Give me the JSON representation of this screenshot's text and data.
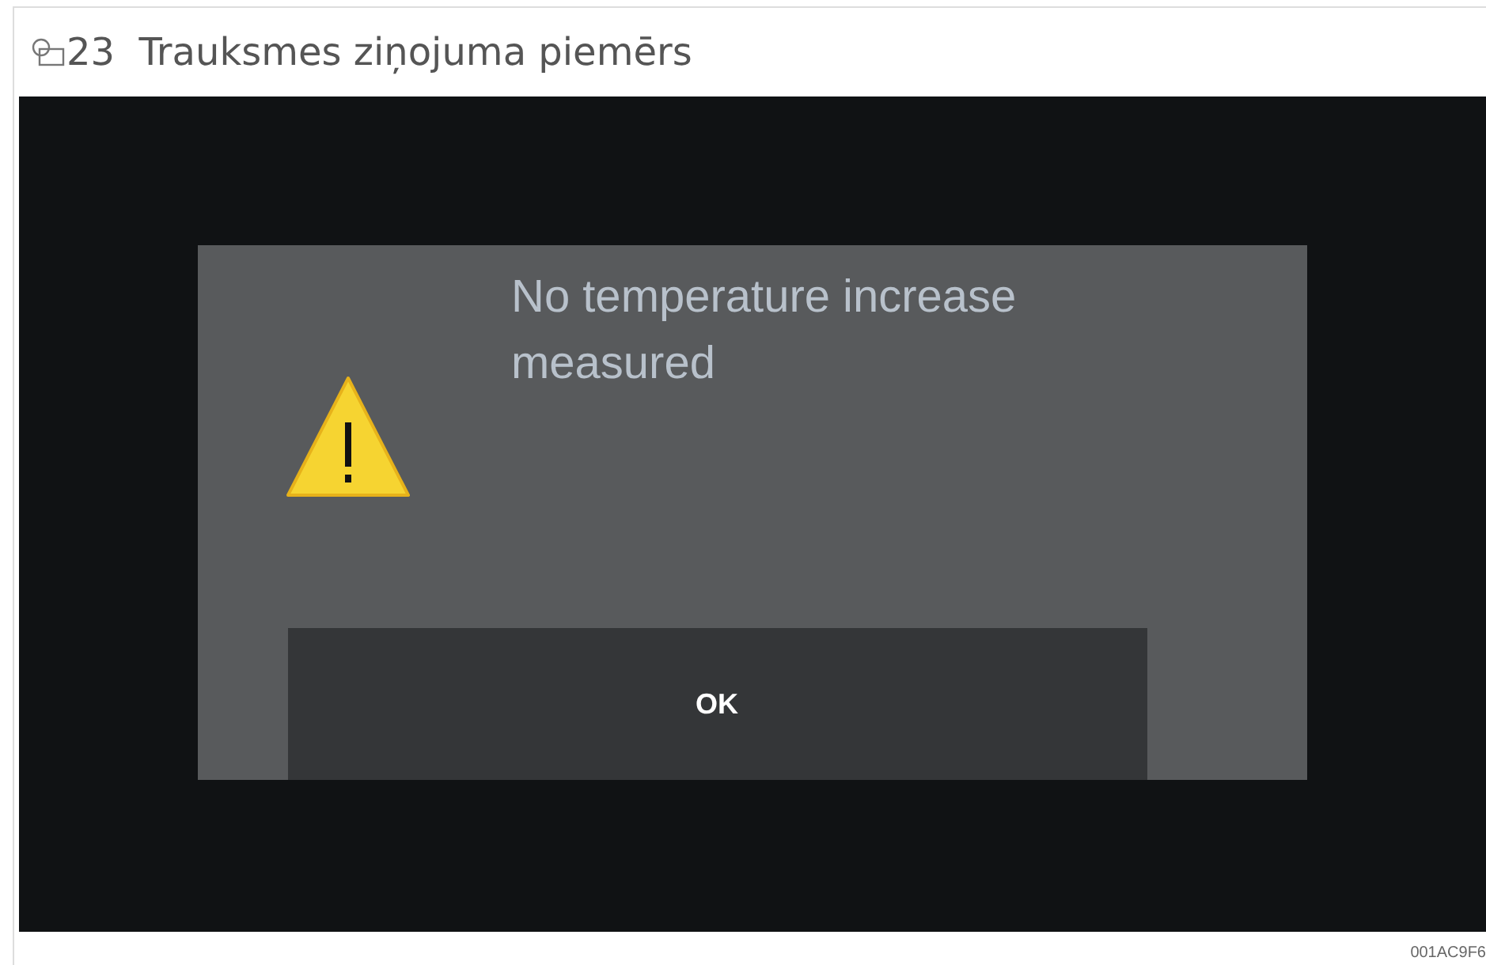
{
  "figure": {
    "title": "23  Trauksmes ziņojuma piemērs",
    "code": "001AC9F6"
  },
  "dialog": {
    "message": "No temperature increase measured",
    "buttons": [
      {
        "label": "OK"
      }
    ]
  }
}
